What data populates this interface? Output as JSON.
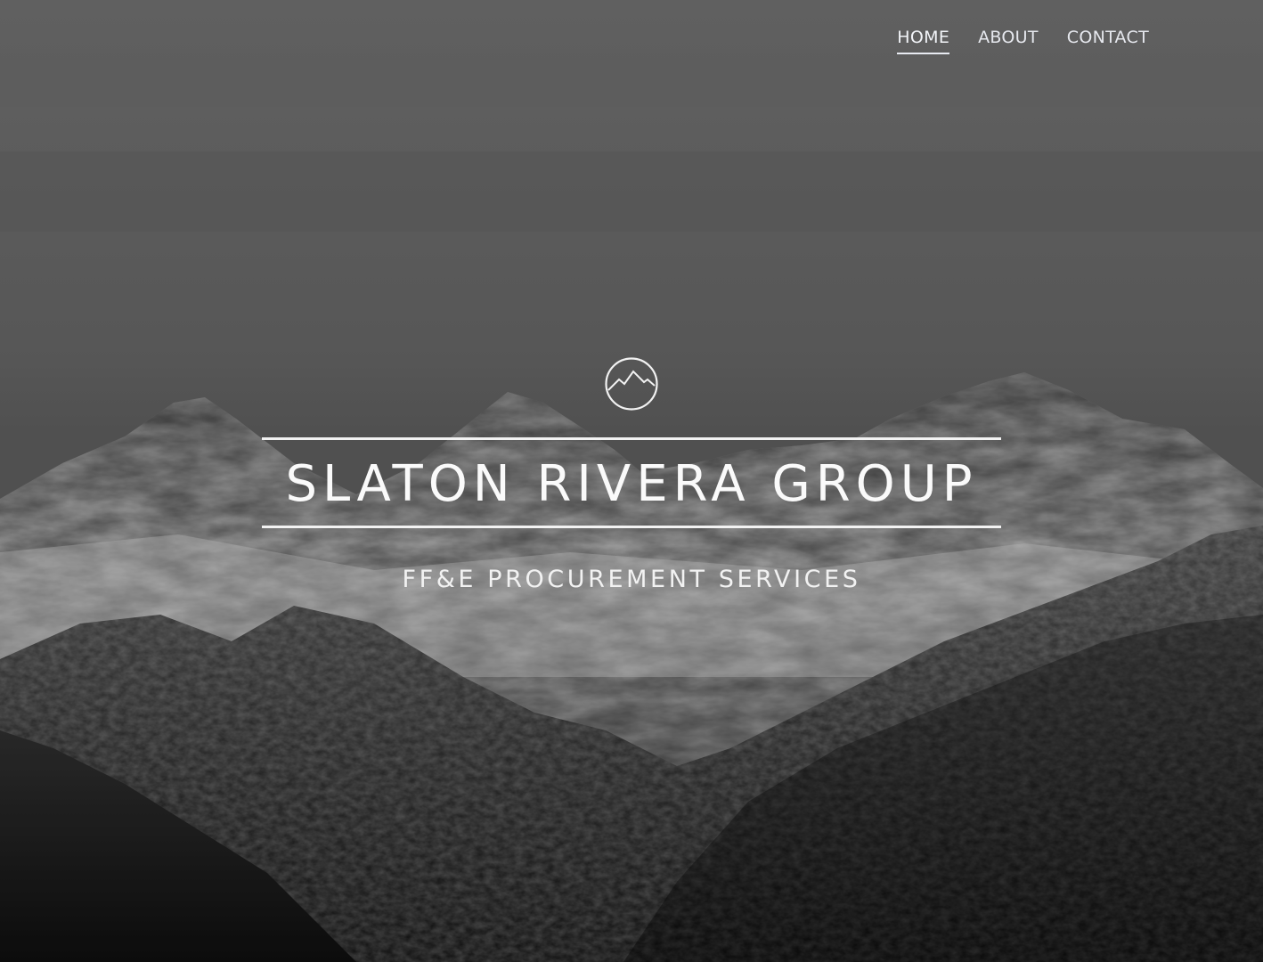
{
  "nav": {
    "items": [
      {
        "label": "HOME",
        "active": true
      },
      {
        "label": "ABOUT",
        "active": false
      },
      {
        "label": "CONTACT",
        "active": false
      }
    ]
  },
  "brand": {
    "logo_icon": "mountain-circle-icon",
    "title": "SLATON RIVERA GROUP",
    "tagline": "FF&E PROCUREMENT SERVICES"
  },
  "background": {
    "subject": "mountain-range-photo",
    "sky_color": "#6b6b6b",
    "snow_color": "#c9c9c9",
    "rock_color": "#2a2a2a"
  }
}
